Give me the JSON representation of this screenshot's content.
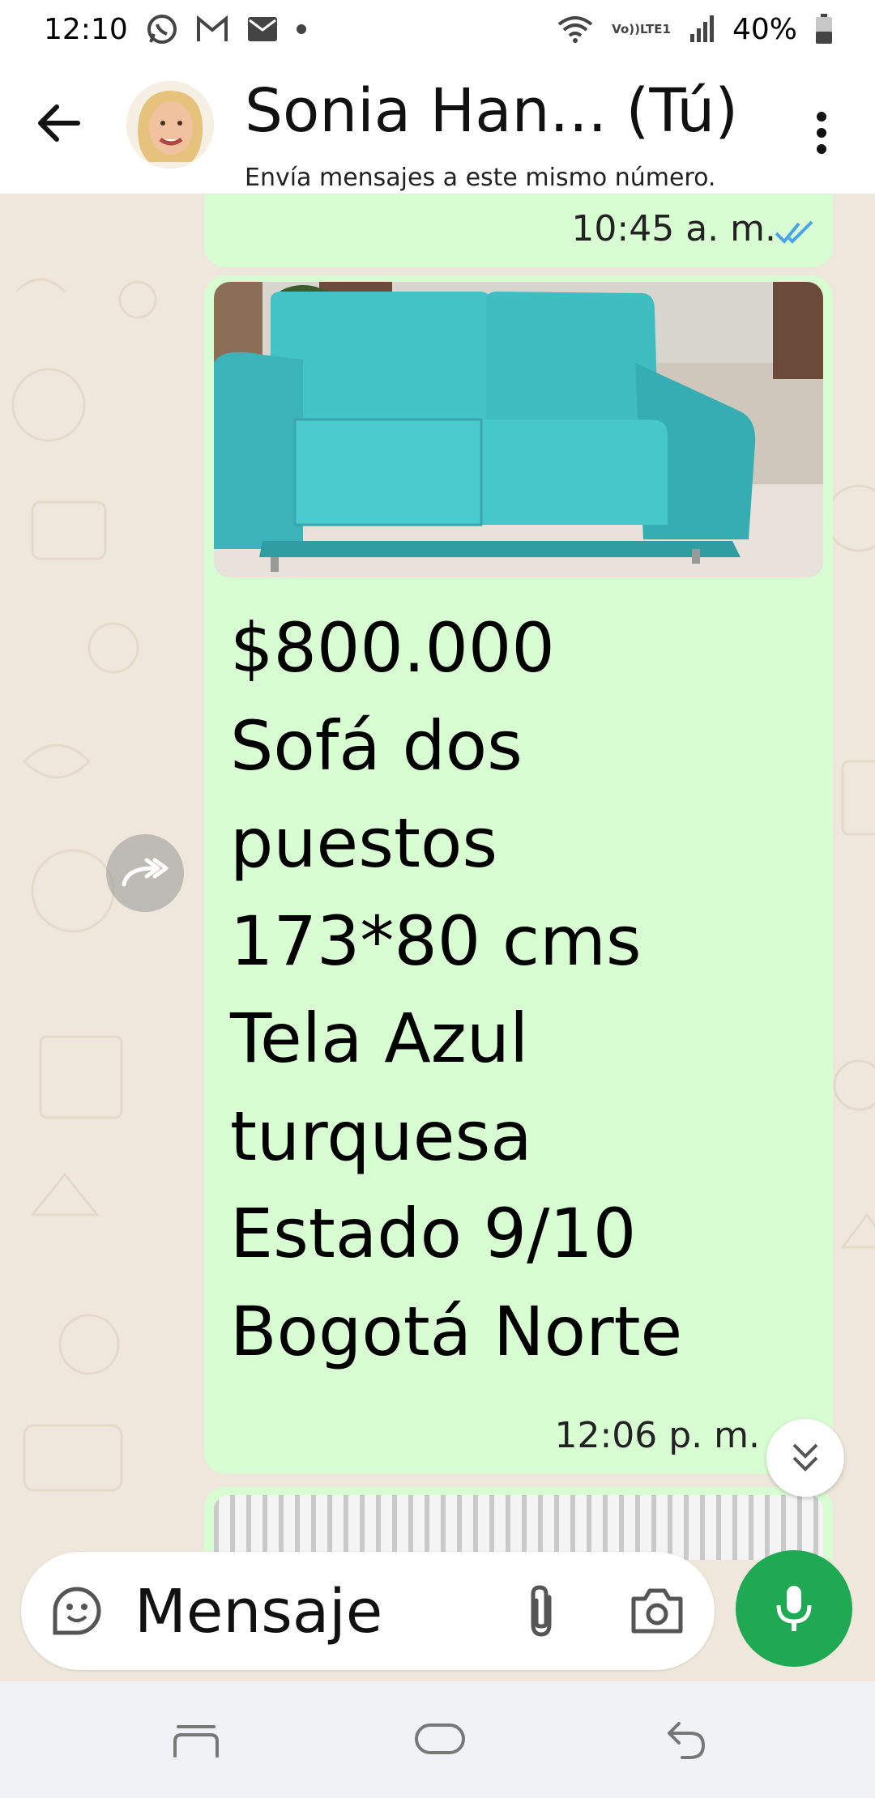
{
  "status_bar": {
    "time": "12:10",
    "network_top": "Vo))",
    "network_bottom": "LTE1",
    "battery": "40%"
  },
  "header": {
    "contact_name": "Sonia Han... (Tú)",
    "subtitle": "Envía mensajes a este mismo número."
  },
  "messages": {
    "top": {
      "time": "10:45 a. m."
    },
    "main": {
      "text": "$800.000\nSofá  dos\npuestos\n173*80 cms\nTela Azul\nturquesa\nEstado 9/10\nBogotá Norte",
      "time": "12:06 p. m."
    }
  },
  "composer": {
    "placeholder": "Mensaje"
  },
  "icons": {
    "back": "back-arrow-icon",
    "menu": "more-vert-icon",
    "read_receipt": "double-check-icon",
    "forward": "forward-icon",
    "scroll_down": "double-chevron-down-icon",
    "sticker": "sticker-icon",
    "attach": "paperclip-icon",
    "camera": "camera-icon",
    "mic": "mic-icon"
  },
  "colors": {
    "bubble": "#d9fdd3",
    "mic_button": "#1ea952",
    "read_tick": "#4aa3e8",
    "sofa": "#3ec4c7"
  }
}
